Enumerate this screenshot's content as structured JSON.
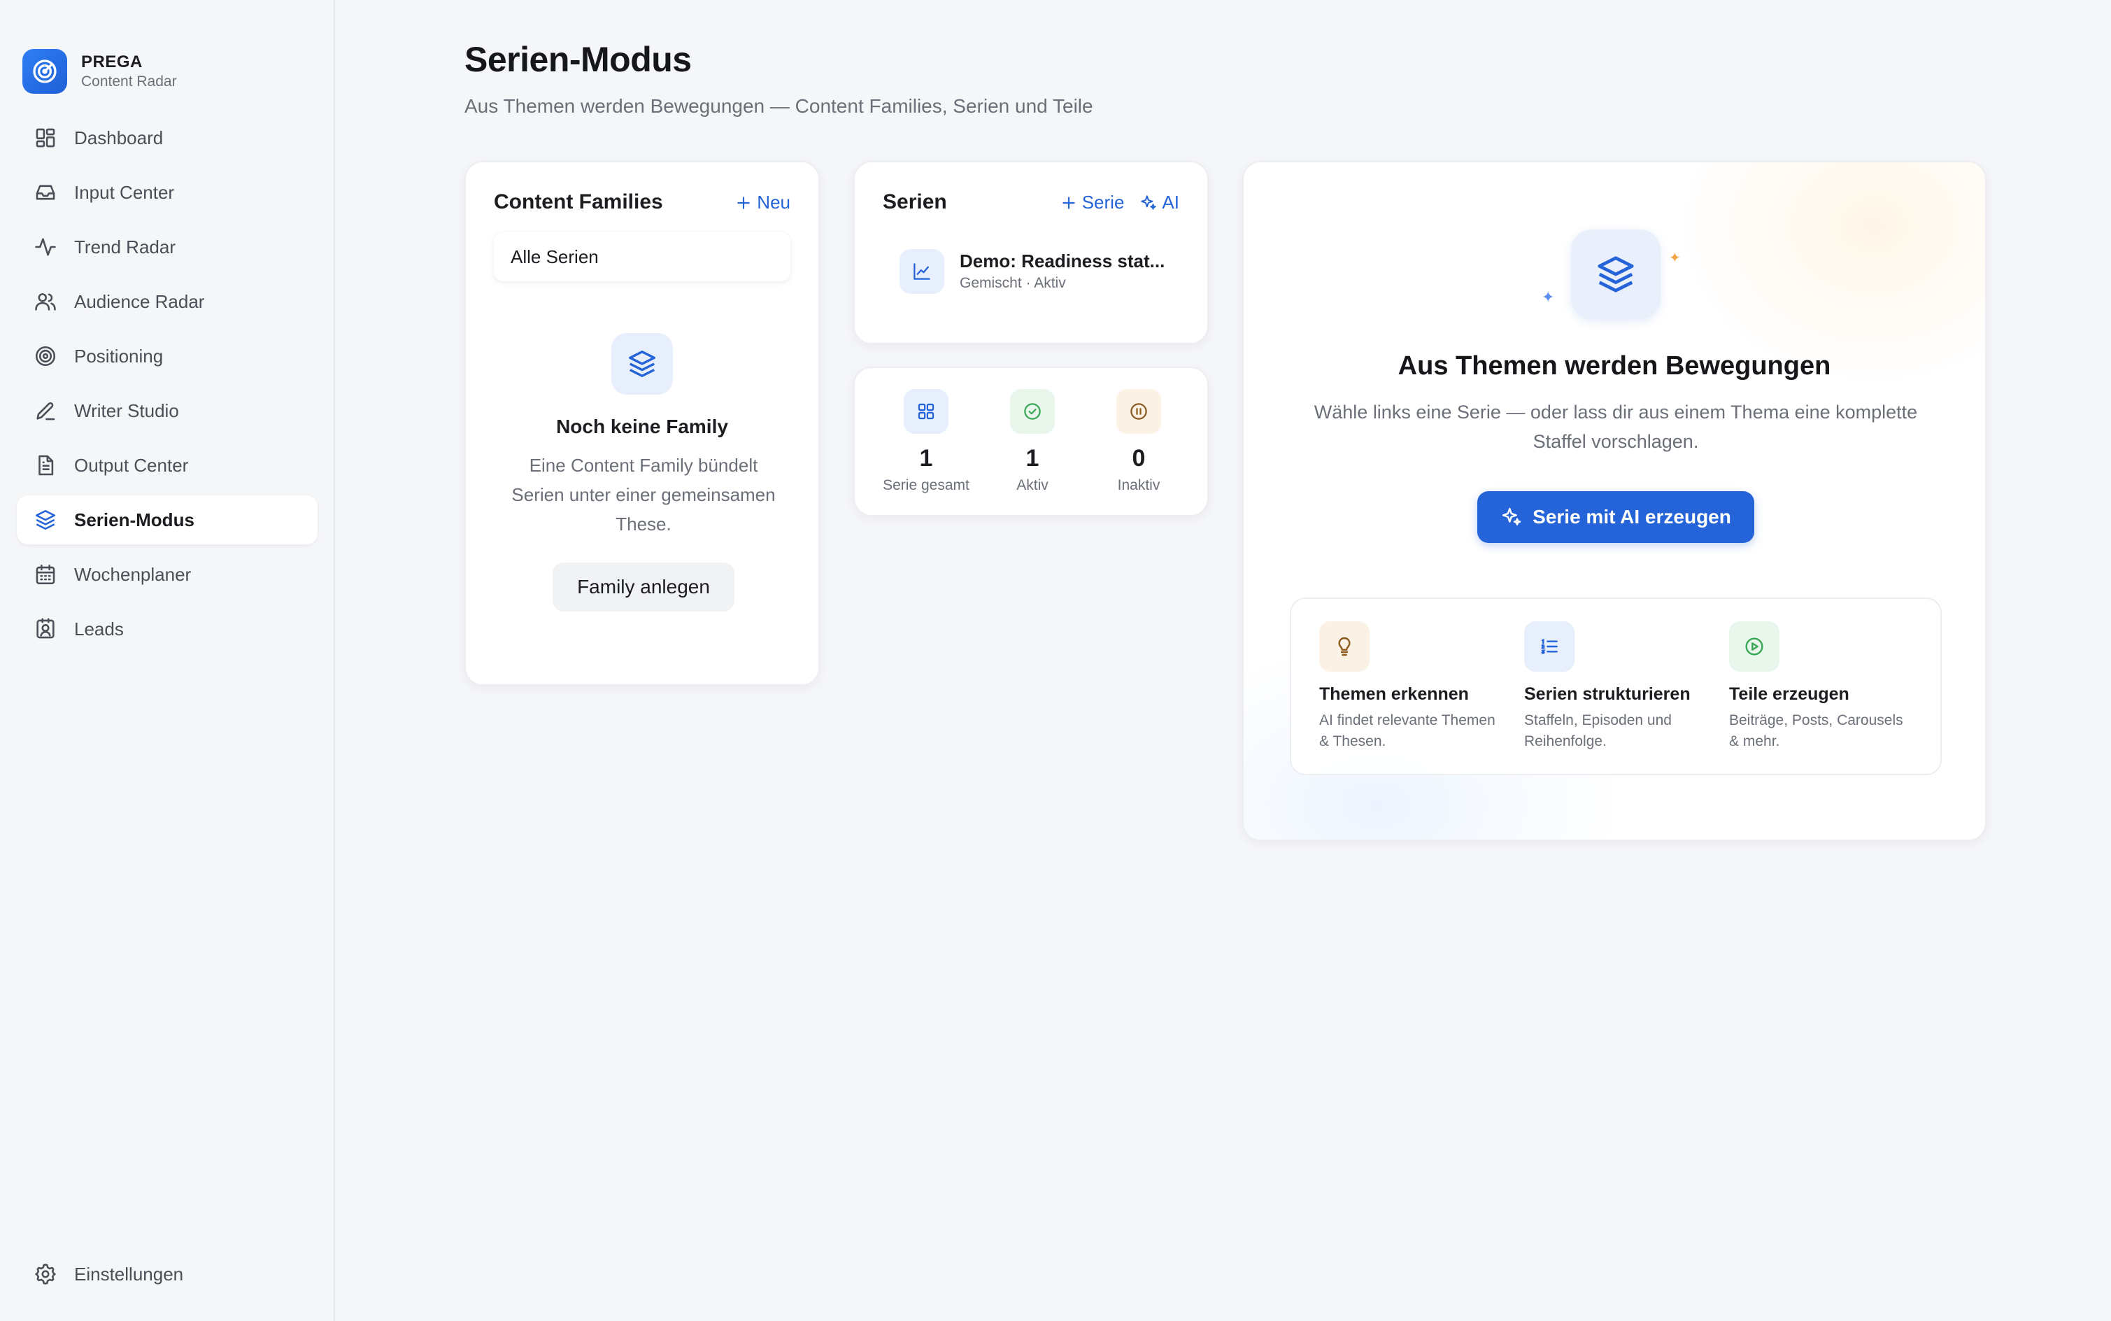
{
  "brand": {
    "name": "PREGA",
    "subtitle": "Content Radar",
    "logo_icon": "radar-icon"
  },
  "sidebar": {
    "items": [
      {
        "label": "Dashboard",
        "icon": "dashboard-grid-icon"
      },
      {
        "label": "Input Center",
        "icon": "inbox-icon"
      },
      {
        "label": "Trend Radar",
        "icon": "activity-icon"
      },
      {
        "label": "Audience Radar",
        "icon": "users-icon"
      },
      {
        "label": "Positioning",
        "icon": "target-icon"
      },
      {
        "label": "Writer Studio",
        "icon": "pen-icon"
      },
      {
        "label": "Output Center",
        "icon": "document-icon"
      },
      {
        "label": "Serien-Modus",
        "icon": "layers-icon",
        "active": true
      },
      {
        "label": "Wochenplaner",
        "icon": "calendar-icon"
      },
      {
        "label": "Leads",
        "icon": "contact-icon"
      }
    ],
    "settings": {
      "label": "Einstellungen",
      "icon": "gear-icon"
    }
  },
  "page": {
    "title": "Serien-Modus",
    "subtitle": "Aus Themen werden Bewegungen — Content Families, Serien und Teile"
  },
  "families": {
    "title": "Content Families",
    "new_label": "Neu",
    "all_series_label": "Alle Serien",
    "empty_title": "Noch keine Family",
    "empty_text": "Eine Content Family bündelt Serien unter einer gemeinsamen These.",
    "create_label": "Family anlegen"
  },
  "series": {
    "title": "Serien",
    "add_label": "Serie",
    "ai_label": "AI",
    "items": [
      {
        "name": "Demo: Readiness stat...",
        "meta": "Gemischt · Aktiv"
      }
    ]
  },
  "stats": [
    {
      "value": "1",
      "label": "Serie gesamt",
      "icon": "grid-icon",
      "color": "#2563d8",
      "bg": "#e7effd"
    },
    {
      "value": "1",
      "label": "Aktiv",
      "icon": "check-circle-icon",
      "color": "#3aa657",
      "bg": "#e9f6ec"
    },
    {
      "value": "0",
      "label": "Inaktiv",
      "icon": "pause-circle-icon",
      "color": "#b2762a",
      "bg": "#fbf1e4"
    }
  ],
  "hero": {
    "title": "Aus Themen werden Bewegungen",
    "text": "Wähle links eine Serie — oder lass dir aus einem Thema eine komplette Staffel vorschlagen.",
    "button_label": "Serie mit AI erzeugen",
    "features": [
      {
        "title": "Themen erkennen",
        "text": "AI findet relevante Themen & Thesen.",
        "icon": "lightbulb-icon",
        "color": "#b2762a",
        "bg": "#fbf1e4"
      },
      {
        "title": "Serien strukturieren",
        "text": "Staffeln, Episoden und Reihenfolge.",
        "icon": "list-ordered-icon",
        "color": "#2563d8",
        "bg": "#e7effd"
      },
      {
        "title": "Teile erzeugen",
        "text": "Beiträge, Posts, Carousels & mehr.",
        "icon": "play-circle-icon",
        "color": "#3aa657",
        "bg": "#e9f6ec"
      }
    ]
  },
  "colors": {
    "accent": "#2563d8",
    "sidebar_bg": "#f5f6f8",
    "card_bg": "#ffffff"
  }
}
